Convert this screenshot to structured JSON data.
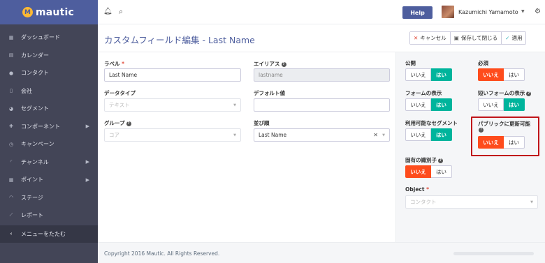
{
  "app": {
    "name": "mautic",
    "logo_letter": "M"
  },
  "sidebar": {
    "items": [
      {
        "label": "ダッシュボード",
        "icon": "th"
      },
      {
        "label": "カレンダー",
        "icon": "calendar"
      },
      {
        "label": "コンタクト",
        "icon": "user"
      },
      {
        "label": "会社",
        "icon": "building"
      },
      {
        "label": "セグメント",
        "icon": "pie-chart"
      },
      {
        "label": "コンポーネント",
        "icon": "puzzle",
        "has_submenu": true
      },
      {
        "label": "キャンペーン",
        "icon": "clock"
      },
      {
        "label": "チャンネル",
        "icon": "rss",
        "has_submenu": true
      },
      {
        "label": "ポイント",
        "icon": "calculator",
        "has_submenu": true
      },
      {
        "label": "ステージ",
        "icon": "tachometer"
      },
      {
        "label": "レポート",
        "icon": "line-chart"
      }
    ],
    "collapse_label": "メニューをたたむ"
  },
  "topbar": {
    "help_label": "Help",
    "user_name": "Kazumichi Yamamoto"
  },
  "page": {
    "title": "カスタムフィールド編集 - Last Name",
    "cancel_label": "キャンセル",
    "save_close_label": "保存して閉じる",
    "apply_label": "適用"
  },
  "form": {
    "label_label": "ラベル",
    "label_value": "Last Name",
    "alias_label": "エイリアス",
    "alias_value": "lastname",
    "datatype_label": "データタイプ",
    "datatype_value": "テキスト",
    "default_label": "デフォルト値",
    "default_value": "",
    "group_label": "グループ",
    "group_value": "コア",
    "order_label": "並び順",
    "order_value": "Last Name"
  },
  "options": {
    "no": "いいえ",
    "yes": "はい",
    "public_label": "公開",
    "required_label": "必須",
    "form_display_label": "フォームの表示",
    "short_form_label": "短いフォームの表示",
    "segment_label": "利用可能なセグメント",
    "publicly_updatable_label": "パブリックに更新可能",
    "unique_id_label": "固有の識別子",
    "object_label": "Object",
    "object_value": "コンタクト"
  },
  "footer": {
    "copyright": "Copyright 2016 Mautic. All Rights Reserved."
  },
  "colors": {
    "accent": "#4e5e9e",
    "yes_on": "#00b49c",
    "no_on": "#fe4c1c",
    "sidebar": "#434557",
    "highlight": "#c0141a"
  }
}
